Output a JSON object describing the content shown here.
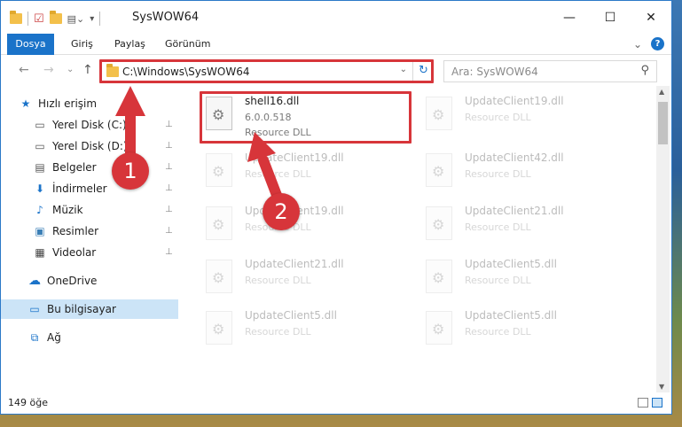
{
  "window": {
    "title": "SysWOW64",
    "controls": {
      "minimize": "—",
      "maximize": "☐",
      "close": "✕"
    }
  },
  "ribbon": {
    "tabs": [
      "Dosya",
      "Giriş",
      "Paylaş",
      "Görünüm"
    ],
    "expand_glyph": "⌄",
    "help_glyph": "?"
  },
  "navbar": {
    "back": "←",
    "forward": "→",
    "recent": "⌄",
    "up": "↑",
    "address": "C:\\Windows\\SysWOW64",
    "address_dropdown": "⌄",
    "refresh": "↻",
    "search_placeholder": "Ara: SysWOW64",
    "search_glyph": "⚲"
  },
  "sidebar": {
    "items": [
      {
        "label": "Hızlı erişim",
        "icon": "star-icon",
        "glyph": "★",
        "color": "#1a73c9"
      },
      {
        "label": "Yerel Disk (C:)",
        "icon": "drive-icon",
        "glyph": "▭",
        "color": "#555555",
        "pinned": true
      },
      {
        "label": "Yerel Disk (D:)",
        "icon": "drive-icon",
        "glyph": "▭",
        "color": "#555555",
        "pinned": true
      },
      {
        "label": "Belgeler",
        "icon": "documents-icon",
        "glyph": "▤",
        "color": "#555555",
        "pinned": true
      },
      {
        "label": "İndirmeler",
        "icon": "download-icon",
        "glyph": "⬇",
        "color": "#1a73c9",
        "pinned": true
      },
      {
        "label": "Müzik",
        "icon": "music-icon",
        "glyph": "♪",
        "color": "#1a73c9",
        "pinned": true
      },
      {
        "label": "Resimler",
        "icon": "pictures-icon",
        "glyph": "▣",
        "color": "#3b7fb6",
        "pinned": true
      },
      {
        "label": "Videolar",
        "icon": "video-icon",
        "glyph": "▦",
        "color": "#444444",
        "pinned": true
      },
      {
        "label": "OneDrive",
        "icon": "cloud-icon",
        "glyph": "☁",
        "color": "#1a73c9"
      },
      {
        "label": "Bu bilgisayar",
        "icon": "computer-icon",
        "glyph": "▭",
        "color": "#1a73c9"
      },
      {
        "label": "Ağ",
        "icon": "network-icon",
        "glyph": "⧉",
        "color": "#1a73c9"
      }
    ],
    "pin_glyph": "📌"
  },
  "files": [
    {
      "name": "shell16.dll",
      "line2": "6.0.0.518",
      "line3": "Resource DLL"
    },
    {
      "name": "UpdateClient19.dll",
      "line2": "Resource DLL"
    },
    {
      "name": "UpdateClient19.dll",
      "line2": "Resource DLL"
    },
    {
      "name": "UpdateClient42.dll",
      "line2": "Resource DLL"
    },
    {
      "name": "UpdateClient19.dll",
      "line2": "Resource DLL"
    },
    {
      "name": "UpdateClient21.dll",
      "line2": "Resource DLL"
    },
    {
      "name": "UpdateClient21.dll",
      "line2": "Resource DLL"
    },
    {
      "name": "UpdateClient5.dll",
      "line2": "Resource DLL"
    },
    {
      "name": "UpdateClient5.dll",
      "line2": "Resource DLL"
    },
    {
      "name": "UpdateClient5.dll",
      "line2": "Resource DLL"
    }
  ],
  "status": {
    "count": "149 öğe"
  },
  "annotations": {
    "step1": "1",
    "step2": "2",
    "color": "#d7353a"
  }
}
